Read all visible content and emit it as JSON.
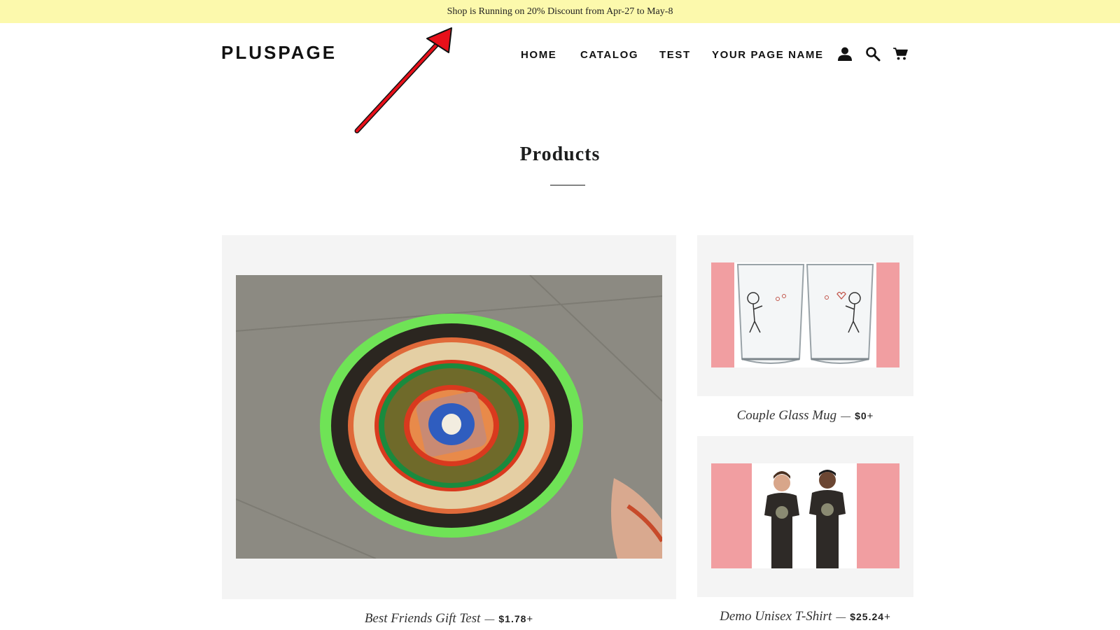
{
  "announcement": {
    "text": "Shop is Running on 20% Discount from Apr-27 to May-8"
  },
  "header": {
    "logo": "PLUSPAGE",
    "nav": [
      {
        "label": "HOME"
      },
      {
        "label": "CATALOG"
      },
      {
        "label": "TEST"
      },
      {
        "label": "YOUR PAGE NAME"
      }
    ],
    "icons": [
      "account-icon",
      "search-icon",
      "cart-icon"
    ]
  },
  "main": {
    "title": "Products",
    "products": [
      {
        "name": "Best Friends Gift Test",
        "dash": "—",
        "price": "$1.78",
        "plus": "+",
        "image": "decorated-thali-plate"
      },
      {
        "name": "Couple Glass Mug",
        "dash": "—",
        "price": "$0",
        "plus": "+",
        "image": "couple-glass-mugs"
      },
      {
        "name": "Demo Unisex T-Shirt",
        "dash": "—",
        "price": "$25.24",
        "plus": "+",
        "image": "couple-in-t-shirts"
      }
    ]
  },
  "colors": {
    "announcement_bg": "#fcf9ac",
    "card_bg": "#f4f4f4",
    "image_pink": "#f19ea1",
    "arrow_red": "#e8101a"
  }
}
